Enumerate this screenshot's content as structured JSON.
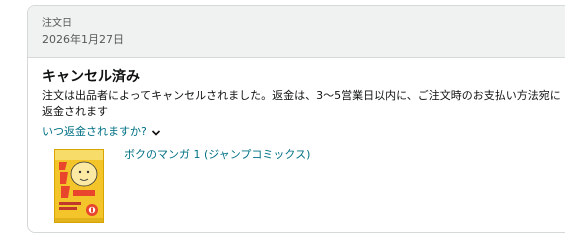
{
  "order": {
    "date_label": "注文日",
    "date_value": "2026年1月27日"
  },
  "status": {
    "title": "キャンセル済み",
    "description": "注文は出品者によってキャンセルされました。返金は、3～5営業日以内に、ご注文時のお支払い方法宛に返金されます",
    "refund_link": "いつ返金されますか?"
  },
  "product": {
    "title": "ボクのマンガ 1 (ジャンプコミックス)",
    "image_icon": "manga-cover-image"
  },
  "colors": {
    "link": "#007185",
    "header_bg": "#f0f2f2",
    "border": "#d5d9d9",
    "cover_yellow": "#f3c52a"
  }
}
